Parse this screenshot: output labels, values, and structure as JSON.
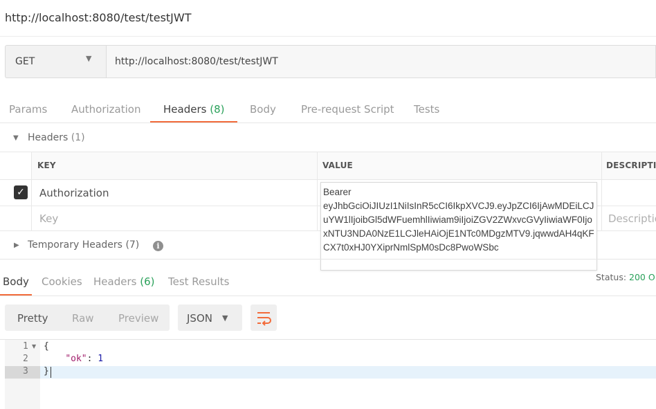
{
  "request": {
    "title": "http://localhost:8080/test/testJWT",
    "method": "GET",
    "url": "http://localhost:8080/test/testJWT"
  },
  "request_tabs": [
    {
      "label": "Params"
    },
    {
      "label": "Authorization"
    },
    {
      "label": "Headers",
      "count": "(8)",
      "active": true
    },
    {
      "label": "Body"
    },
    {
      "label": "Pre-request Script"
    },
    {
      "label": "Tests"
    }
  ],
  "headers_section": {
    "label": "Headers",
    "count": "(1)",
    "columns": [
      "KEY",
      "VALUE",
      "DESCRIPTIO"
    ],
    "rows": [
      {
        "checked": true,
        "key": "Authorization",
        "value": "Bearer\neyJhbGciOiJIUzI1NiIsInR5cCI6IkpXVCJ9.eyJpZCI6IjAwMDEiLCJuYW1lIjoibGl5dWFuemhlIiwiam9iIjoiZGV2ZWxvcGVyIiwiaWF0IjoxNTU3NDA0NzE1LCJleHAiOjE1NTc0MDgzMTV9.jqwwdAH4qKFCX7t0xHJ0YXiprNmlSpM0sDc8PwoWSbc"
      },
      {
        "key_placeholder": "Key",
        "desc_placeholder": "Descriptio"
      }
    ]
  },
  "temporary_headers": {
    "label": "Temporary Headers",
    "count": "(7)",
    "info_glyph": "i"
  },
  "response_tabs": [
    {
      "label": "Body",
      "active": true
    },
    {
      "label": "Cookies"
    },
    {
      "label": "Headers",
      "count": "(6)"
    },
    {
      "label": "Test Results"
    }
  ],
  "status": {
    "label": "Status:",
    "value": "200 O"
  },
  "view_modes": [
    "Pretty",
    "Raw",
    "Preview"
  ],
  "format": "JSON",
  "code_lines": [
    {
      "num": "1",
      "text": "{"
    },
    {
      "num": "2",
      "key": "\"ok\"",
      "sep": ": ",
      "val": "1"
    },
    {
      "num": "3",
      "text": "}"
    }
  ],
  "icons": {
    "check": "✓",
    "caret_down": "▼",
    "caret_right": "▶",
    "fold": "▼",
    "wrap": "wrap-lines-icon"
  },
  "colors": {
    "accent": "#f26b3a",
    "success": "#2aa15a"
  }
}
